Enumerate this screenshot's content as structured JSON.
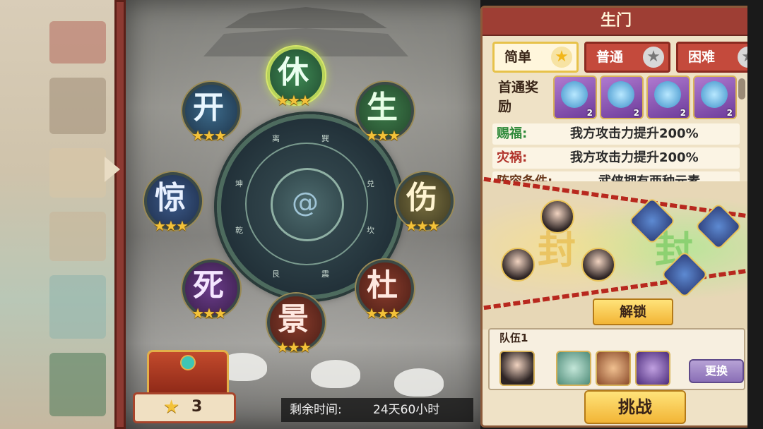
{
  "gates": [
    {
      "char": "休",
      "stars": "★★★",
      "selected": true
    },
    {
      "char": "生",
      "stars": "★★★"
    },
    {
      "char": "伤",
      "stars": "★★★"
    },
    {
      "char": "杜",
      "stars": "★★★"
    },
    {
      "char": "景",
      "stars": "★★★"
    },
    {
      "char": "死",
      "stars": "★★★"
    },
    {
      "char": "惊",
      "stars": "★★★"
    },
    {
      "char": "开",
      "stars": "★★★"
    }
  ],
  "wheel": {
    "trigrams": [
      "离",
      "巽",
      "坤",
      "兑",
      "乾",
      "坎",
      "艮",
      "震"
    ],
    "center_icon": "swirl-icon"
  },
  "bottom": {
    "star_count": "3",
    "time_label": "剩余时间:",
    "time_value": "24天60小时"
  },
  "panel": {
    "title": "生门",
    "tabs": [
      {
        "label": "简单",
        "active": true
      },
      {
        "label": "普通"
      },
      {
        "label": "困难"
      }
    ],
    "reward_label": "首通奖励",
    "rewards": [
      {
        "qty": "2",
        "icon": "orb-icon"
      },
      {
        "qty": "2",
        "icon": "orb-icon"
      },
      {
        "qty": "2",
        "icon": "orb-icon"
      },
      {
        "qty": "2",
        "icon": "orb-icon"
      }
    ],
    "blessing": {
      "label": "赐福:",
      "value": "我方攻击力提升200%",
      "color": "#2f8a3a"
    },
    "disaster": {
      "label": "灾祸:",
      "value": "我方攻击力提升200%",
      "color": "#b0322a"
    },
    "condition": {
      "label": "阵容条件:",
      "value": "武侠拥有两种元素",
      "color": "#6b3a1e"
    },
    "seal_char": "封",
    "unlock_label": "解锁",
    "team_label": "队伍1",
    "swap_label": "更换",
    "challenge_label": "挑战"
  }
}
